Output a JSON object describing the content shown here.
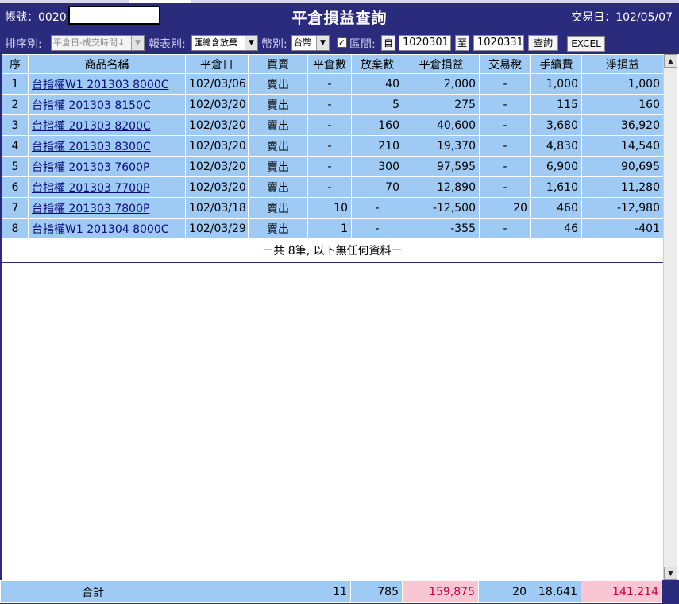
{
  "header": {
    "account_label": "帳號：0020",
    "title": "平倉損益查詢",
    "trade_date": "交易日：102/05/07"
  },
  "toolbar": {
    "sort_label": "排序別:",
    "sort_value": "平倉日-成交時間↓",
    "report_label": "報表別:",
    "report_value": "匯總含放棄",
    "currency_label": "幣別:",
    "currency_value": "台幣",
    "range_checked": "✓",
    "range_label": "區間:",
    "from_label": "自",
    "from_value": "1020301",
    "to_label": "至",
    "to_value": "1020331",
    "query_button": "查詢",
    "excel_button": "EXCEL"
  },
  "table": {
    "columns": [
      "序",
      "商品名稱",
      "平倉日",
      "買賣",
      "平倉數",
      "放棄數",
      "平倉損益",
      "交易稅",
      "手續費",
      "淨損益"
    ],
    "rows": [
      [
        "1",
        "台指權W1 201303 8000C",
        "102/03/06",
        "賣出",
        "-",
        "40",
        "2,000",
        "-",
        "1,000",
        "1,000"
      ],
      [
        "2",
        "台指權 201303 8150C",
        "102/03/20",
        "賣出",
        "-",
        "5",
        "275",
        "-",
        "115",
        "160"
      ],
      [
        "3",
        "台指權 201303 8200C",
        "102/03/20",
        "賣出",
        "-",
        "160",
        "40,600",
        "-",
        "3,680",
        "36,920"
      ],
      [
        "4",
        "台指權 201303 8300C",
        "102/03/20",
        "賣出",
        "-",
        "210",
        "19,370",
        "-",
        "4,830",
        "14,540"
      ],
      [
        "5",
        "台指權 201303 7600P",
        "102/03/20",
        "賣出",
        "-",
        "300",
        "97,595",
        "-",
        "6,900",
        "90,695"
      ],
      [
        "6",
        "台指權 201303 7700P",
        "102/03/20",
        "賣出",
        "-",
        "70",
        "12,890",
        "-",
        "1,610",
        "11,280"
      ],
      [
        "7",
        "台指權 201303 7800P",
        "102/03/18",
        "賣出",
        "10",
        "-",
        "-12,500",
        "20",
        "460",
        "-12,980"
      ],
      [
        "8",
        "台指權W1 201304 8000C",
        "102/03/29",
        "賣出",
        "1",
        "-",
        "-355",
        "-",
        "46",
        "-401"
      ]
    ],
    "footer_note": "ー共 8筆, 以下無任何資料ー"
  },
  "totals": {
    "label": "合計",
    "close_qty": "11",
    "abandon_qty": "785",
    "close_pnl": "159,875",
    "tax": "20",
    "fee": "18,641",
    "net_pnl": "141,214"
  },
  "colors": {
    "header_bg": "#2b2b7e",
    "row_bg": "#9ecaf4",
    "highlight_bg": "#f9c6d4",
    "highlight_text": "#c8003c"
  }
}
